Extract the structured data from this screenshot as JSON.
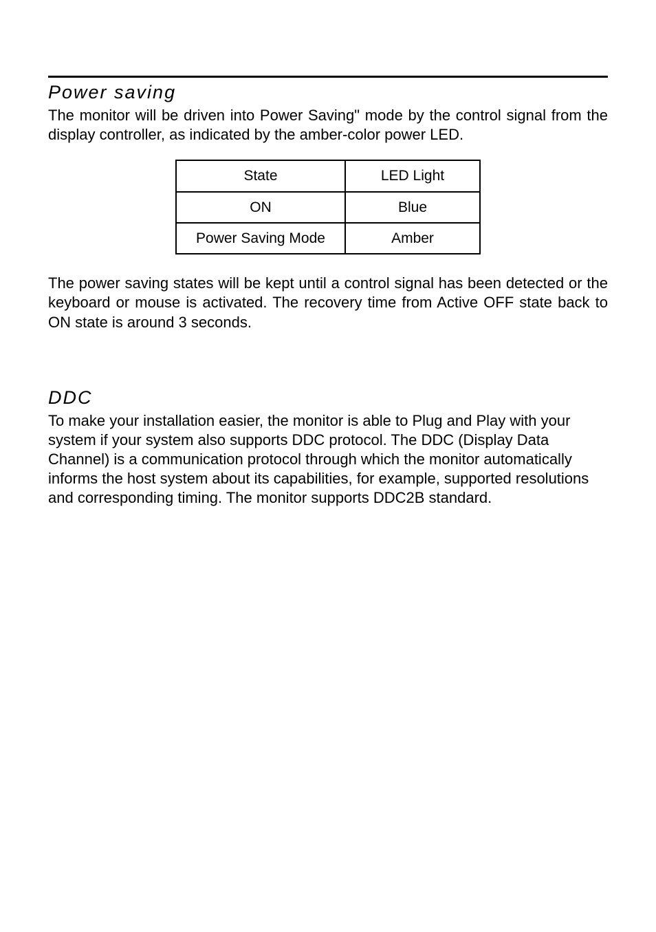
{
  "section1": {
    "heading": "Power saving",
    "intro": "The monitor will be driven into Power Saving\" mode by the control signal from the display controller, as indicated by the amber-color power LED.",
    "table": {
      "headers": [
        "State",
        "LED Light"
      ],
      "rows": [
        {
          "state": "ON",
          "led": "Blue"
        },
        {
          "state": "Power Saving Mode",
          "led": "Amber"
        }
      ]
    },
    "outro": "The power saving states will be kept until a control signal has been detected or the keyboard or mouse is activated. The recovery time from Active OFF state back to ON state is around 3 seconds."
  },
  "section2": {
    "heading": "DDC",
    "body": "To make your installation easier, the monitor is able to Plug and Play with your system if your system also supports DDC protocol. The DDC (Display Data Channel) is a communication protocol through which the monitor automatically informs the host system  about its capabilities, for example, supported resolutions and corresponding timing. The monitor supports DDC2B standard."
  }
}
